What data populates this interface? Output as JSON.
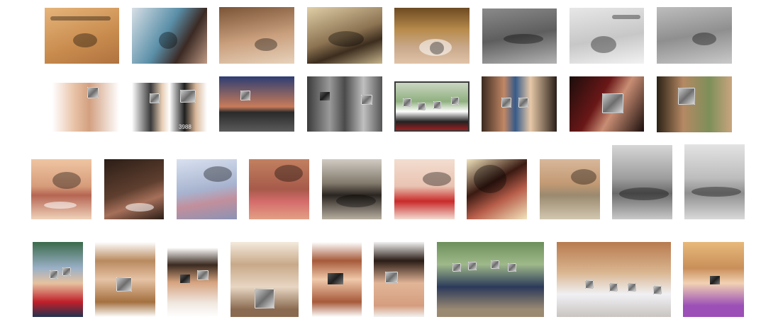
{
  "grid": {
    "rows": [
      {
        "subject": "eyes",
        "tiles": 8
      },
      {
        "subject": "faces-with-eye-patches",
        "tiles": 8
      },
      {
        "subject": "mouths-and-noses",
        "tiles": 10
      },
      {
        "subject": "faces-with-mouth-patches",
        "tiles": 9
      }
    ]
  },
  "overlay_numbers": {
    "r2_2": "3988"
  },
  "colors": {
    "background": "#ffffff",
    "patch": "#8a8a8a"
  }
}
